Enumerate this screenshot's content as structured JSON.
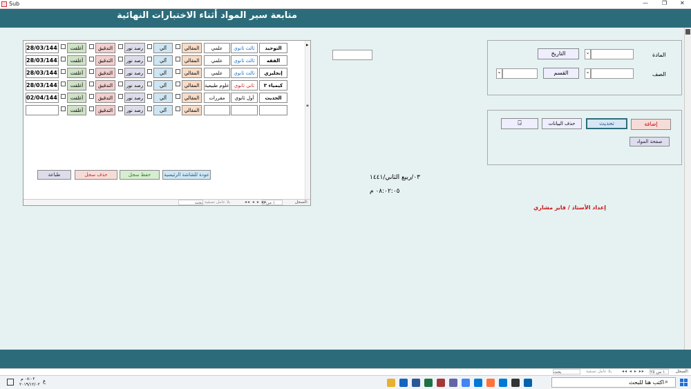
{
  "window": {
    "title": "Sub",
    "controls": [
      "—",
      "❐",
      "✕"
    ]
  },
  "header": {
    "title": "متابعة سير المواد أثناء الاختبارات النهائية"
  },
  "subform": {
    "rows": [
      {
        "subject": "التوحيد",
        "grade": "ثالث ثانوي",
        "track": "علمي",
        "hall": "المقالي",
        "teacher": "آلي",
        "proctor": "رصد نور",
        "check": "التدقيق",
        "close": "أغلقت",
        "date": "28/03/1441",
        "grade_color": "#1a6fc4"
      },
      {
        "subject": "الفقه",
        "grade": "ثالث ثانوي",
        "track": "علمي",
        "hall": "المقالي",
        "teacher": "آلي",
        "proctor": "رصد نور",
        "check": "التدقيق",
        "close": "أغلقت",
        "date": "28/03/1441",
        "grade_color": "#1a6fc4"
      },
      {
        "subject": "إنجليزي",
        "grade": "ثالث ثانوي",
        "track": "علمي",
        "hall": "المقالي",
        "teacher": "آلي",
        "proctor": "رصد نور",
        "check": "التدقيق",
        "close": "أغلقت",
        "date": "28/03/1441",
        "grade_color": "#1a6fc4"
      },
      {
        "subject": "كيمياء ٣",
        "grade": "ثاني ثانوي",
        "track": "علوم طبيعية",
        "hall": "المقالي",
        "teacher": "آلي",
        "proctor": "رصد نور",
        "check": "التدقيق",
        "close": "أغلقت",
        "date": "28/03/1441",
        "grade_color": "#cc2222"
      },
      {
        "subject": "الحديث",
        "grade": "أول ثانوي",
        "track": "مقررات",
        "hall": "المقالي",
        "teacher": "آلي",
        "proctor": "رصد نور",
        "check": "التدقيق",
        "close": "أغلقت",
        "date": "02/04/1441",
        "grade_color": "#000000"
      },
      {
        "subject": "",
        "grade": "",
        "track": "",
        "hall": "المقالي",
        "teacher": "آلي",
        "proctor": "رصد نور",
        "check": "التدقيق",
        "close": "أغلقت",
        "date": "",
        "grade_color": "#000000"
      }
    ],
    "buttons": {
      "back": "عودة للشاشة الرئيسية",
      "save": "حفظ سجل",
      "delete": "حذف سجل",
      "print": "طباعة"
    },
    "nav": {
      "label": "السجل:",
      "position": "١ من ٥",
      "filter": "بلا عامل تصفية",
      "search": "بحث"
    },
    "new_marker": "*",
    "current_marker": "▸"
  },
  "filter_panel": {
    "subject_label": "المادة",
    "date_button": "التاريخ",
    "class_label": "الصف",
    "section_button": "القسم"
  },
  "actions_panel": {
    "add": "إضافة",
    "update": "تحديث",
    "delete_data": "حذف البيانات",
    "subjects_page": "صفحة المواد",
    "exit_icon": "exit-door-icon"
  },
  "info": {
    "hijri_date": "٠٣/ربيع الثاني/١٤٤١",
    "time": "٠٨:٠٢:٠٥ م",
    "author": "إعداد الأستاذ / فايز مشاري"
  },
  "bottom_nav": {
    "label": "السجل:",
    "position": "١ من ٢٥",
    "filter": "بلا عامل تصفية",
    "search": "بحث"
  },
  "taskbar": {
    "search_placeholder": "اكتب هنا للبحث",
    "clock_time": "٠٨:٠٢ م",
    "clock_date": "٢٠١٩/١٢/٠٢",
    "lang": "ع"
  },
  "colors": {
    "header": "#2c6c7a",
    "background": "#e6f1f2",
    "hall": "#f7dcc8",
    "teacher": "#cfe6f2",
    "proctor": "#dcdcea",
    "check": "#f2cfcf",
    "close": "#cfe2c6",
    "add_text": "#cc1111",
    "author_text": "#cc1111"
  }
}
